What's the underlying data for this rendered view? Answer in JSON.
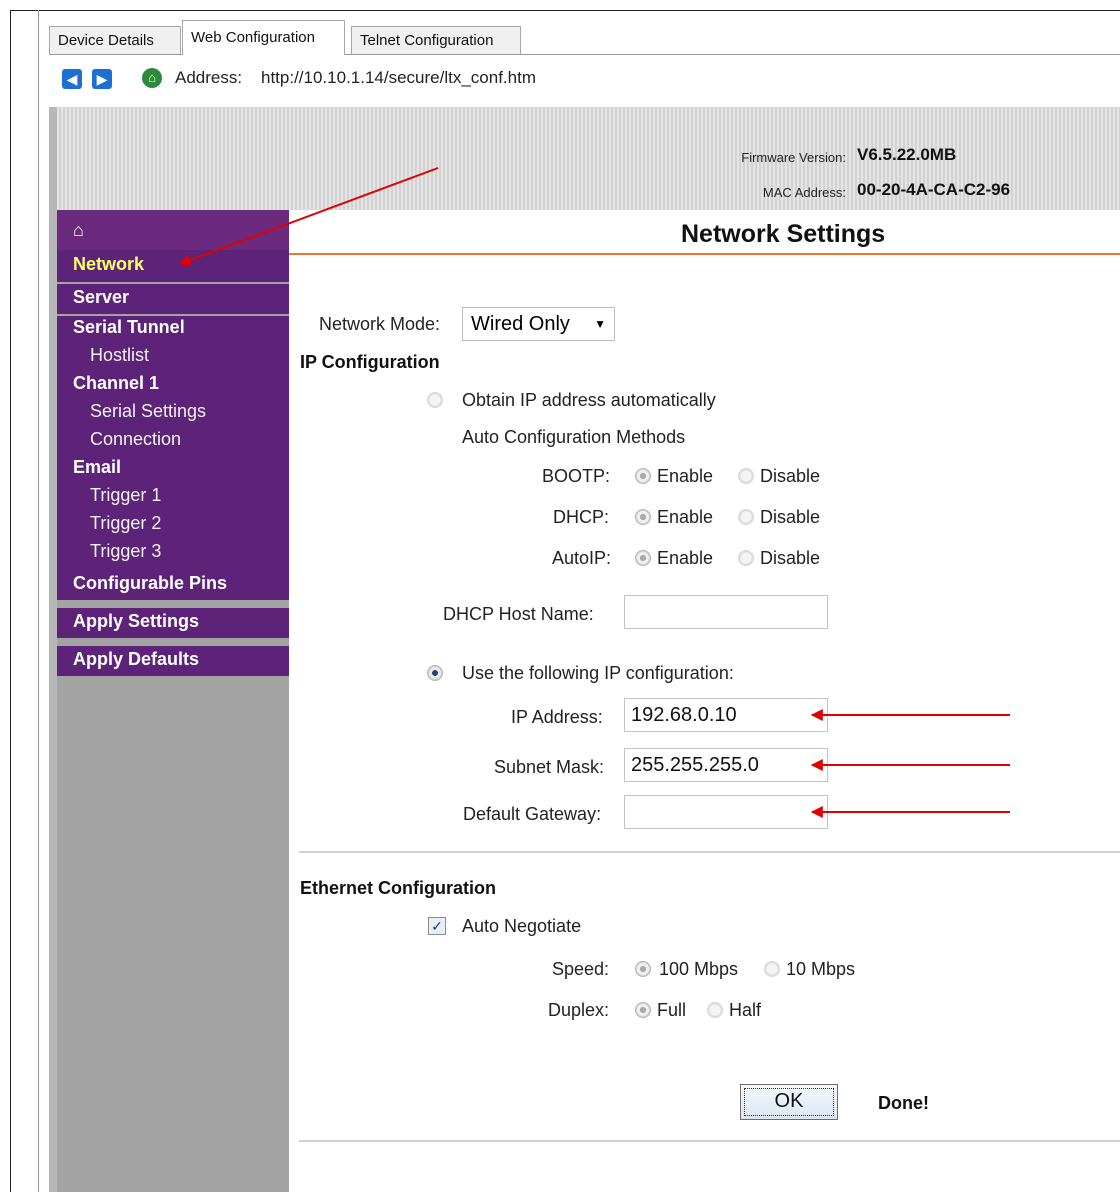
{
  "tabs": [
    {
      "label": "Device Details"
    },
    {
      "label": "Web Configuration"
    },
    {
      "label": "Telnet Configuration"
    }
  ],
  "address_bar": {
    "label": "Address:",
    "url": "http://10.10.1.14/secure/ltx_conf.htm",
    "back_icon": "back-arrow-icon",
    "forward_icon": "forward-arrow-icon",
    "home_icon": "home-icon"
  },
  "banner": {
    "firmware_label": "Firmware Version:",
    "firmware_value": "V6.5.22.0MB",
    "mac_label": "MAC Address:",
    "mac_value": "00-20-4A-CA-C2-96"
  },
  "sidebar": {
    "home_icon": "house-icon",
    "network": "Network",
    "server": "Server",
    "serial_tunnel": "Serial Tunnel",
    "hostlist": "Hostlist",
    "channel1": "Channel 1",
    "serial_settings": "Serial Settings",
    "connection": "Connection",
    "email": "Email",
    "trigger1": "Trigger 1",
    "trigger2": "Trigger 2",
    "trigger3": "Trigger 3",
    "configurable_pins": "Configurable Pins",
    "apply_settings": "Apply Settings",
    "apply_defaults": "Apply Defaults",
    "colors": {
      "menu_bg": "#5c2379",
      "active_text": "#ffff66",
      "panel": "#a3a3a3"
    }
  },
  "main": {
    "title": "Network Settings",
    "network_mode_label": "Network Mode:",
    "network_mode_value": "Wired Only",
    "ip_config_heading": "IP Configuration",
    "obtain_auto": "Obtain IP address automatically",
    "auto_methods": "Auto Configuration Methods",
    "bootp_label": "BOOTP:",
    "dhcp_label": "DHCP:",
    "autoip_label": "AutoIP:",
    "enable": "Enable",
    "disable": "Disable",
    "dhcp_host_label": "DHCP Host Name:",
    "dhcp_host_value": "",
    "use_following": "Use the following IP configuration:",
    "ip_label": "IP Address:",
    "ip_value": "192.68.0.10",
    "subnet_label": "Subnet Mask:",
    "subnet_value": "255.255.255.0",
    "gateway_label": "Default Gateway:",
    "gateway_value": "",
    "ethernet_heading": "Ethernet Configuration",
    "auto_negotiate": "Auto Negotiate",
    "auto_negotiate_checked": true,
    "speed_label": "Speed:",
    "speed_100": "100 Mbps",
    "speed_10": "10 Mbps",
    "duplex_label": "Duplex:",
    "duplex_full": "Full",
    "duplex_half": "Half",
    "ok_button": "OK",
    "status": "Done!",
    "accent_color": "#e87a2a"
  },
  "annotations": {
    "arrow_color": "#e00000"
  }
}
